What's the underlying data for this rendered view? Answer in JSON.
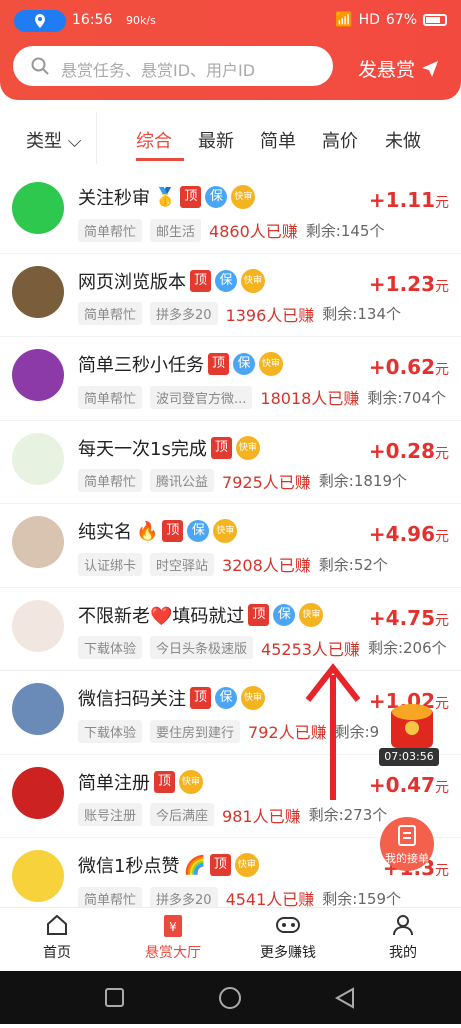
{
  "status": {
    "time": "16:56",
    "speed": "90k/s",
    "network": "HD",
    "battery": "67%"
  },
  "header": {
    "search_placeholder": "悬赏任务、悬赏ID、用户ID",
    "post_label": "发悬赏"
  },
  "filters": {
    "type_label": "类型",
    "tabs": [
      "综合",
      "最新",
      "简单",
      "高价",
      "未做"
    ],
    "active": "综合"
  },
  "tasks": [
    {
      "title": "关注秒审",
      "emoji": "🥇",
      "badges": [
        "顶",
        "保",
        "快审"
      ],
      "price": "+1.11",
      "unit": "元",
      "tags": [
        "简单帮忙",
        "邮生活"
      ],
      "earned": "4860人已赚",
      "remain": "剩余:145个"
    },
    {
      "title": "网页浏览版本",
      "emoji": "",
      "badges": [
        "顶",
        "保",
        "快审"
      ],
      "price": "+1.23",
      "unit": "元",
      "tags": [
        "简单帮忙",
        "拼多多20"
      ],
      "earned": "1396人已赚",
      "remain": "剩余:134个"
    },
    {
      "title": "简单三秒小任务",
      "emoji": "",
      "badges": [
        "顶",
        "保",
        "快审"
      ],
      "price": "+0.62",
      "unit": "元",
      "tags": [
        "简单帮忙",
        "波司登官方微..."
      ],
      "earned": "18018人已赚",
      "remain": "剩余:704个"
    },
    {
      "title": "每天一次1s完成",
      "emoji": "",
      "badges": [
        "顶",
        "快审"
      ],
      "price": "+0.28",
      "unit": "元",
      "tags": [
        "简单帮忙",
        "腾讯公益"
      ],
      "earned": "7925人已赚",
      "remain": "剩余:1819个"
    },
    {
      "title": "纯实名",
      "emoji": "🔥",
      "badges": [
        "顶",
        "保",
        "快审"
      ],
      "price": "+4.96",
      "unit": "元",
      "tags": [
        "认证绑卡",
        "时空驿站"
      ],
      "earned": "3208人已赚",
      "remain": "剩余:52个"
    },
    {
      "title": "不限新老❤️填码就过",
      "emoji": "",
      "badges": [
        "顶",
        "保",
        "快审"
      ],
      "price": "+4.75",
      "unit": "元",
      "tags": [
        "下载体验",
        "今日头条极速版"
      ],
      "earned": "45253人已赚",
      "remain": "剩余:206个"
    },
    {
      "title": "微信扫码关注",
      "emoji": "",
      "badges": [
        "顶",
        "保",
        "快审"
      ],
      "price": "+1.02",
      "unit": "元",
      "tags": [
        "下载体验",
        "要住房到建行"
      ],
      "earned": "792人已赚",
      "remain": "剩余:9"
    },
    {
      "title": "简单注册",
      "emoji": "",
      "badges": [
        "顶",
        "快审"
      ],
      "price": "+0.47",
      "unit": "元",
      "tags": [
        "账号注册",
        "今后满座"
      ],
      "earned": "981人已赚",
      "remain": "剩余:273个"
    },
    {
      "title": "微信1秒点赞",
      "emoji": "🌈",
      "badges": [
        "顶",
        "快审"
      ],
      "price": "+1.3",
      "unit": "元",
      "tags": [
        "简单帮忙",
        "拼多多20"
      ],
      "earned": "4541人已赚",
      "remain": "剩余:159个"
    }
  ],
  "floating": {
    "timer": "07:03:56",
    "order_label": "我的接单"
  },
  "bottom_nav": [
    "首页",
    "悬赏大厅",
    "更多赚钱",
    "我的"
  ],
  "colors": {
    "brand": "#f2503f",
    "price": "#e3322e",
    "active": "#e84a3e"
  }
}
